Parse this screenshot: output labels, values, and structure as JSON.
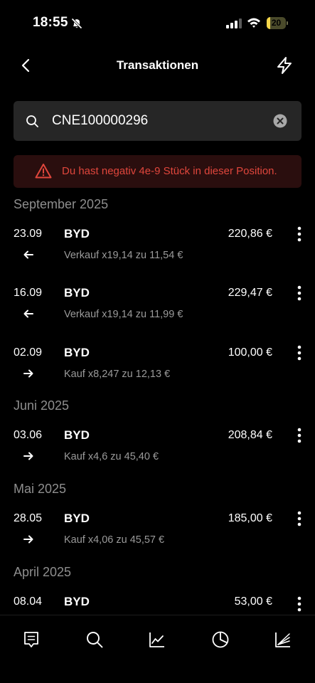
{
  "status_bar": {
    "time": "18:55",
    "battery": "20",
    "battery_level": 0.2
  },
  "nav": {
    "title": "Transaktionen"
  },
  "search": {
    "value": "CNE100000296"
  },
  "warning": {
    "text": "Du hast negativ 4e-9 Stück in dieser Position."
  },
  "colors": {
    "warning": "#e0463c",
    "background": "#000000",
    "muted": "#8e8e8e"
  },
  "months": [
    "September 2025",
    "Juni 2025",
    "Mai 2025",
    "April 2025"
  ],
  "transactions": [
    {
      "date": "23.09",
      "name": "BYD",
      "amount": "220,86  €",
      "direction": "out",
      "detail": "Verkauf x19,14 zu 11,54 €"
    },
    {
      "date": "16.09",
      "name": "BYD",
      "amount": "229,47  €",
      "direction": "out",
      "detail": "Verkauf x19,14 zu 11,99 €"
    },
    {
      "date": "02.09",
      "name": "BYD",
      "amount": "100,00  €",
      "direction": "in",
      "detail": "Kauf x8,247 zu 12,13 €"
    },
    {
      "date": "03.06",
      "name": "BYD",
      "amount": "208,84  €",
      "direction": "in",
      "detail": "Kauf x4,6 zu 45,40 €"
    },
    {
      "date": "28.05",
      "name": "BYD",
      "amount": "185,00  €",
      "direction": "in",
      "detail": "Kauf x4,06 zu 45,57 €"
    },
    {
      "date": "08.04",
      "name": "BYD",
      "amount": "53,00  €",
      "direction": "in",
      "detail": ""
    }
  ],
  "tabs": [
    "feed-icon",
    "search-icon",
    "chart-icon",
    "pie-chart-icon",
    "lines-icon"
  ]
}
